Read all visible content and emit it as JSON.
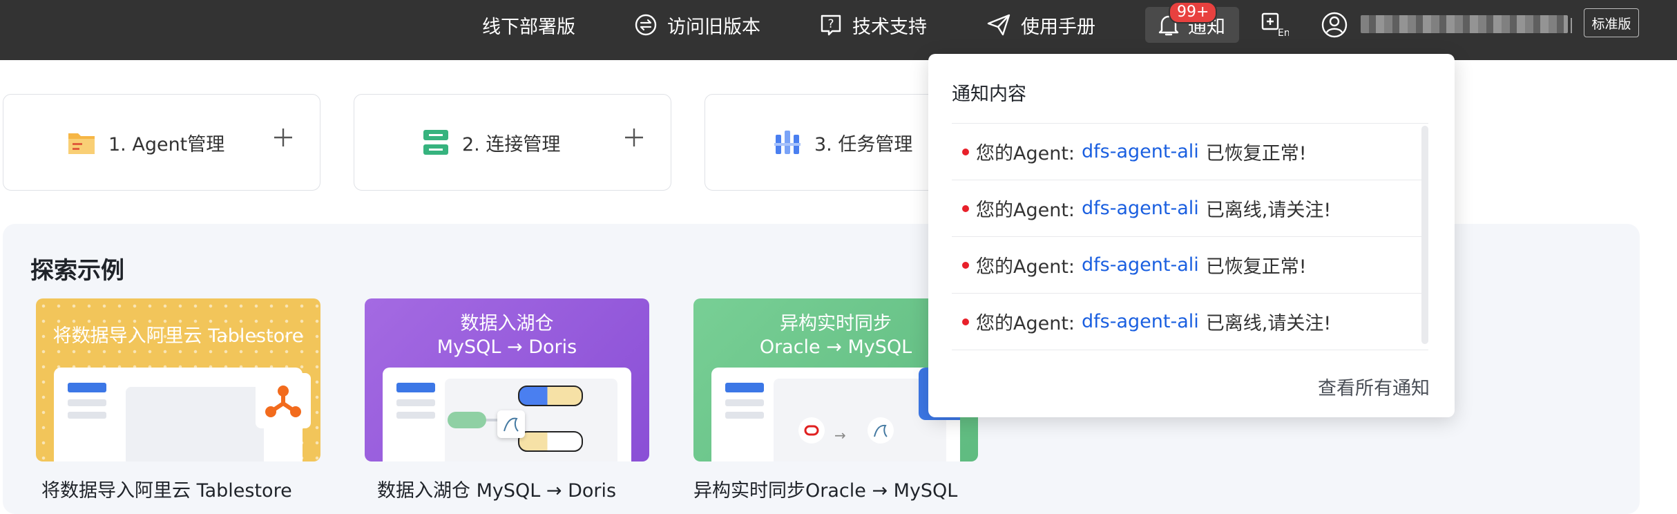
{
  "header": {
    "offline": "线下部署版",
    "old_version": "访问旧版本",
    "support": "技术支持",
    "manual": "使用手册",
    "notify": "通知",
    "badge": "99+",
    "edition": "标准版"
  },
  "steps": [
    {
      "label": "1. Agent管理"
    },
    {
      "label": "2. 连接管理"
    },
    {
      "label": "3. 任务管理"
    }
  ],
  "explore": {
    "title": "探索示例",
    "cards": [
      {
        "head": "将数据导入阿里云 Tablestore",
        "caption": "将数据导入阿里云 Tablestore",
        "color": "#f2c55a"
      },
      {
        "head_line1": "数据入湖仓",
        "head_line2": "MySQL → Doris",
        "caption": "数据入湖仓 MySQL → Doris",
        "color": "#9a5bdc"
      },
      {
        "head_line1": "异构实时同步",
        "head_line2": "Oracle → MySQL",
        "caption": "异构实时同步Oracle → MySQL",
        "color": "#6cc48a"
      }
    ]
  },
  "notifications": {
    "title": "通知内容",
    "items": [
      {
        "prefix": "您的Agent:",
        "agent": "dfs-agent-ali",
        "status": "已恢复正常!"
      },
      {
        "prefix": "您的Agent:",
        "agent": "dfs-agent-ali",
        "status": "已离线,请关注!"
      },
      {
        "prefix": "您的Agent:",
        "agent": "dfs-agent-ali",
        "status": "已恢复正常!"
      },
      {
        "prefix": "您的Agent:",
        "agent": "dfs-agent-ali",
        "status": "已离线,请关注!"
      }
    ],
    "view_all": "查看所有通知"
  },
  "colors": {
    "topbar": "#333333",
    "link": "#1a5fe0",
    "badge": "#e8413f",
    "status_dot": "#e8202a"
  }
}
